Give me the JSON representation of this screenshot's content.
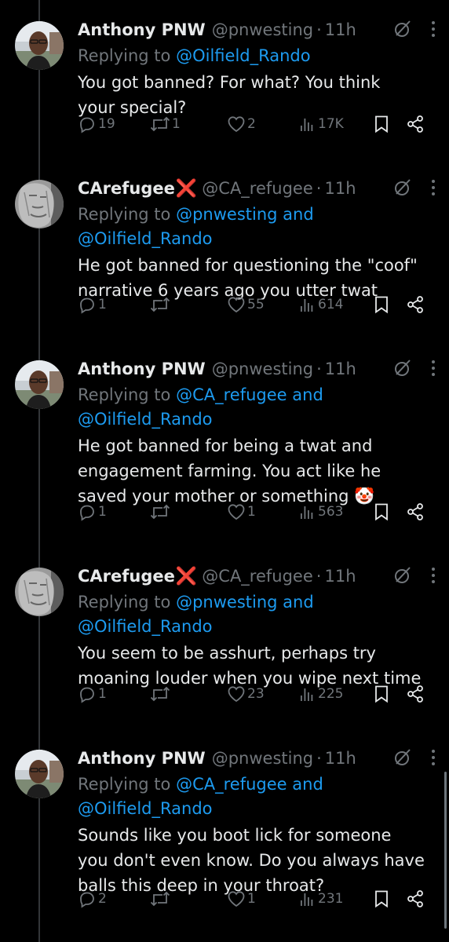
{
  "tweets": [
    {
      "name": "Anthony PNW",
      "badge": "",
      "handle": "@pnwesting",
      "time": "11h",
      "replying_prefix": "Replying to",
      "replying_to": [
        "@Oilfield_Rando"
      ],
      "joiner": "",
      "text": [
        "You got banned? For what? You think",
        "your special?"
      ],
      "emoji": "",
      "replies": "19",
      "retweets": "1",
      "likes": "2",
      "views": "17K",
      "avatar": "anthony"
    },
    {
      "name": "CArefugee",
      "badge": "❌",
      "handle": "@CA_refugee",
      "time": "11h",
      "replying_prefix": "Replying to",
      "replying_to": [
        "@pnwesting and",
        "@Oilfield_Rando"
      ],
      "joiner": "",
      "text": [
        "He got banned for questioning the \"coof\"",
        "narrative 6 years ago you utter twat"
      ],
      "emoji": "",
      "replies": "1",
      "retweets": "",
      "likes": "55",
      "views": "614",
      "avatar": "carefugee"
    },
    {
      "name": "Anthony PNW",
      "badge": "",
      "handle": "@pnwesting",
      "time": "11h",
      "replying_prefix": "Replying to",
      "replying_to": [
        "@CA_refugee and",
        "@Oilfield_Rando"
      ],
      "joiner": "",
      "text": [
        "He got banned for being a twat and",
        "engagement farming. You act like he",
        "saved your mother or something"
      ],
      "emoji": "🤡",
      "replies": "1",
      "retweets": "",
      "likes": "1",
      "views": "563",
      "avatar": "anthony"
    },
    {
      "name": "CArefugee",
      "badge": "❌",
      "handle": "@CA_refugee",
      "time": "11h",
      "replying_prefix": "Replying to",
      "replying_to": [
        "@pnwesting and",
        "@Oilfield_Rando"
      ],
      "joiner": "",
      "text": [
        "You seem to be asshurt, perhaps try",
        "moaning louder when you wipe next time"
      ],
      "emoji": "",
      "replies": "1",
      "retweets": "",
      "likes": "23",
      "views": "225",
      "avatar": "carefugee"
    },
    {
      "name": "Anthony PNW",
      "badge": "",
      "handle": "@pnwesting",
      "time": "11h",
      "replying_prefix": "Replying to",
      "replying_to": [
        "@CA_refugee and",
        "@Oilfield_Rando"
      ],
      "joiner": "",
      "text": [
        "Sounds like you boot lick for someone",
        "you don't even know. Do you always have",
        "balls this deep in your throat?"
      ],
      "emoji": "",
      "replies": "2",
      "retweets": "",
      "likes": "1",
      "views": "231",
      "avatar": "anthony"
    }
  ],
  "icons": {
    "reply": "reply-icon",
    "retweet": "retweet-icon",
    "like": "like-icon",
    "views": "views-icon",
    "bookmark": "bookmark-icon",
    "share": "share-icon",
    "grok": "grok-icon",
    "more": "more-icon"
  },
  "colors": {
    "background": "#000000",
    "text": "#e7e9ea",
    "muted": "#71767b",
    "link": "#1d9bf0",
    "badge": "#f4212e"
  }
}
